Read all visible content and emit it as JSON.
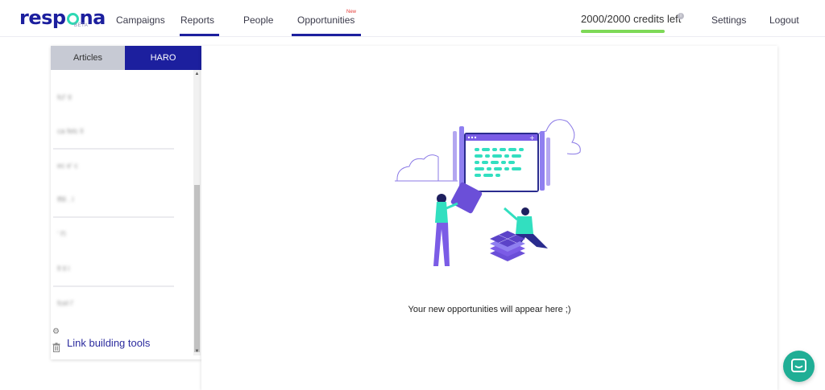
{
  "brand": {
    "name_prefix": "resp",
    "name_suffix": "na",
    "badge": "BETA"
  },
  "nav": {
    "items": [
      {
        "label": "Campaigns",
        "active": false
      },
      {
        "label": "Reports",
        "active": true
      },
      {
        "label": "People",
        "active": false
      },
      {
        "label": "Opportunities",
        "active": true,
        "badge": "New"
      }
    ],
    "credits_text": "2000/2000 credits left",
    "credits_fraction": 1.0,
    "settings_label": "Settings",
    "logout_label": "Logout"
  },
  "left_panel": {
    "tabs": [
      {
        "label": "Articles",
        "selected": false
      },
      {
        "label": "HARO",
        "selected": true
      }
    ],
    "items": [
      "fcl' tl",
      "ca felc ll",
      "ec e' c",
      "fflll . l",
      "' f'l",
      "fl ll l",
      "fcel l'"
    ],
    "tools_label": "Link building tools"
  },
  "main": {
    "empty_message": "Your new opportunities will appear here ;)"
  },
  "colors": {
    "brand": "#1c1f9e",
    "accent": "#2ed9b4",
    "purple": "#7b5ce6",
    "credits_bar": "#7ed957",
    "chat": "#1fae95"
  },
  "icons": {
    "info": "info-icon",
    "gear": "gear-icon",
    "trash": "trash-icon",
    "chat": "chat-icon"
  }
}
